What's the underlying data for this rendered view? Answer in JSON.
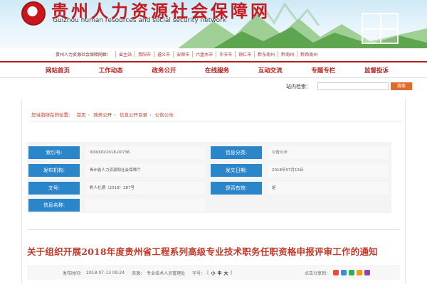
{
  "header": {
    "title": "贵州人力资源社会保障网",
    "subtitle": "Guizhou human resources and social security network"
  },
  "affiliates": {
    "lead": "贵州人力资源社会保障网群：",
    "items": [
      "省主站",
      "贵阳市",
      "遵义市",
      "安顺市",
      "六盘水市",
      "毕节市",
      "铜仁市",
      "黔东南州",
      "黔南州",
      "黔西南州"
    ]
  },
  "nav": {
    "items": [
      "网站首页",
      "工作动态",
      "政务公开",
      "在线服务",
      "互动交流",
      "专题专栏",
      "监督投诉"
    ]
  },
  "search": {
    "label": "站内检索：",
    "placeholder": "",
    "button": "搜索"
  },
  "breadcrumb": {
    "lead": "您当前所在的位置：",
    "items": [
      "首页",
      "政务公开",
      "信息公开目录",
      "公告公示"
    ]
  },
  "info": {
    "index_label": "索引号:",
    "index_value": "000000/2018-00736",
    "category_label": "信息分类:",
    "category_value": "公告公示",
    "org_label": "发布机构:",
    "org_value": "贵州省人力资源和社会保障厅",
    "date_label": "发文日期:",
    "date_value": "2018年07月13日",
    "docno_label": "文号:",
    "docno_value": "黔人社通〔2018〕287号",
    "valid_label": "是否有效:",
    "valid_value": "是",
    "name_label": "信息名称:",
    "name_value": ""
  },
  "article": {
    "title": "关于组织开展2018年度贵州省工程系列高级专业技术职务任职资格申报评审工作的通知",
    "meta_time_label": "发布时间：",
    "meta_time": "2018-07-13 09:24",
    "meta_source_label": "来源：",
    "meta_source": "专业技术人员管理处",
    "meta_fontsize_label": "字号：",
    "font_small": "小",
    "font_medium": "中",
    "font_large": "大",
    "share_label": "点击分享到："
  },
  "colors": {
    "brand_red": "#b71c1c",
    "label_blue": "#2a86c9",
    "share_colors": [
      "#e74c3c",
      "#3b8ed8",
      "#2fb24c",
      "#f39c12",
      "#8e44ad"
    ]
  }
}
